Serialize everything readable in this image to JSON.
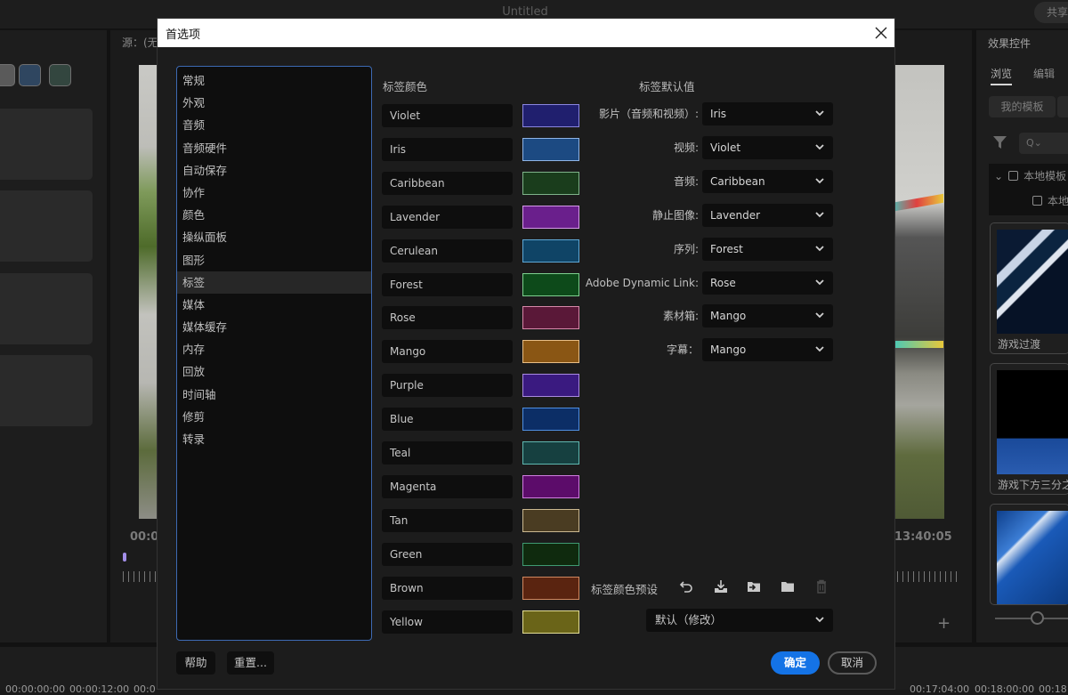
{
  "app": {
    "title": "Untitled",
    "share_label": "共享",
    "source_label": "源：(无",
    "timecode_left": "00:0",
    "timecode_right": "13:40:05",
    "left_swatches": [
      "#5a5a5a",
      "#2f4660",
      "#33463f"
    ],
    "timeline_timecodes": [
      "00:00:00:00",
      "00:00:12:00",
      "00:0",
      "00:17:04:00",
      "00:18:00:00",
      "00:18"
    ]
  },
  "effects_panel": {
    "title": "效果控件",
    "tabs": [
      {
        "label": "浏览",
        "active": true
      },
      {
        "label": "编辑",
        "active": false
      }
    ],
    "my_templates_label": "我的模板",
    "search_placeholder": "Q⌄",
    "tree": [
      {
        "label": "本地模板",
        "expanded": true
      },
      {
        "label": "本地"
      }
    ],
    "templates": [
      {
        "label": "游戏过渡"
      },
      {
        "label": "游戏下方三分之一"
      },
      {
        "label": ""
      }
    ]
  },
  "dialog": {
    "title": "首选项",
    "categories": [
      {
        "label": "常规",
        "active": false
      },
      {
        "label": "外观",
        "active": false
      },
      {
        "label": "音频",
        "active": false
      },
      {
        "label": "音频硬件",
        "active": false
      },
      {
        "label": "自动保存",
        "active": false
      },
      {
        "label": "协作",
        "active": false
      },
      {
        "label": "颜色",
        "active": false
      },
      {
        "label": "操纵面板",
        "active": false
      },
      {
        "label": "图形",
        "active": false
      },
      {
        "label": "标签",
        "active": true
      },
      {
        "label": "媒体",
        "active": false
      },
      {
        "label": "媒体缓存",
        "active": false
      },
      {
        "label": "内存",
        "active": false
      },
      {
        "label": "回放",
        "active": false
      },
      {
        "label": "时间轴",
        "active": false
      },
      {
        "label": "修剪",
        "active": false
      },
      {
        "label": "转录",
        "active": false
      }
    ],
    "label_colors_heading": "标签颜色",
    "label_colors": [
      {
        "name": "Violet",
        "color": "#201f6e",
        "border": "#8a86e0"
      },
      {
        "name": "Iris",
        "color": "#1c4a82",
        "border": "#8fb4e6"
      },
      {
        "name": "Caribbean",
        "color": "#1a3d1c",
        "border": "#7fb48a"
      },
      {
        "name": "Lavender",
        "color": "#6a1f8c",
        "border": "#d49ae8"
      },
      {
        "name": "Cerulean",
        "color": "#0f4466",
        "border": "#5fa8d6"
      },
      {
        "name": "Forest",
        "color": "#0d4a1a",
        "border": "#7ed08f"
      },
      {
        "name": "Rose",
        "color": "#5a1838",
        "border": "#d888aa"
      },
      {
        "name": "Mango",
        "color": "#8a5614",
        "border": "#e8be86"
      },
      {
        "name": "Purple",
        "color": "#3a1a80",
        "border": "#a98ae0"
      },
      {
        "name": "Blue",
        "color": "#0c2e66",
        "border": "#4f8ee0"
      },
      {
        "name": "Teal",
        "color": "#164040",
        "border": "#5fb8b0"
      },
      {
        "name": "Magenta",
        "color": "#5c0c6a",
        "border": "#d07ee0"
      },
      {
        "name": "Tan",
        "color": "#4a3c22",
        "border": "#cbb890"
      },
      {
        "name": "Green",
        "color": "#0f2a0e",
        "border": "#3e9a72"
      },
      {
        "name": "Brown",
        "color": "#5a2410",
        "border": "#d08860"
      },
      {
        "name": "Yellow",
        "color": "#6a6418",
        "border": "#e4de96"
      }
    ],
    "label_defaults_heading": "标签默认值",
    "label_defaults": [
      {
        "label": "影片（音频和视频）:",
        "value": "Iris"
      },
      {
        "label": "视频:",
        "value": "Violet"
      },
      {
        "label": "音频:",
        "value": "Caribbean"
      },
      {
        "label": "静止图像:",
        "value": "Lavender"
      },
      {
        "label": "序列:",
        "value": "Forest"
      },
      {
        "label": "Adobe Dynamic Link:",
        "value": "Rose"
      },
      {
        "label": "素材箱:",
        "value": "Mango"
      },
      {
        "label": "字幕：",
        "value": "Mango"
      }
    ],
    "preset": {
      "label": "标签颜色预设",
      "value": "默认（修改）",
      "icons": [
        "undo-icon",
        "download-icon",
        "import-folder-icon",
        "folder-icon",
        "trash-icon"
      ]
    },
    "buttons": {
      "help": "帮助",
      "reset": "重置...",
      "ok": "确定",
      "cancel": "取消"
    },
    "accent_color": "#1473e6"
  }
}
